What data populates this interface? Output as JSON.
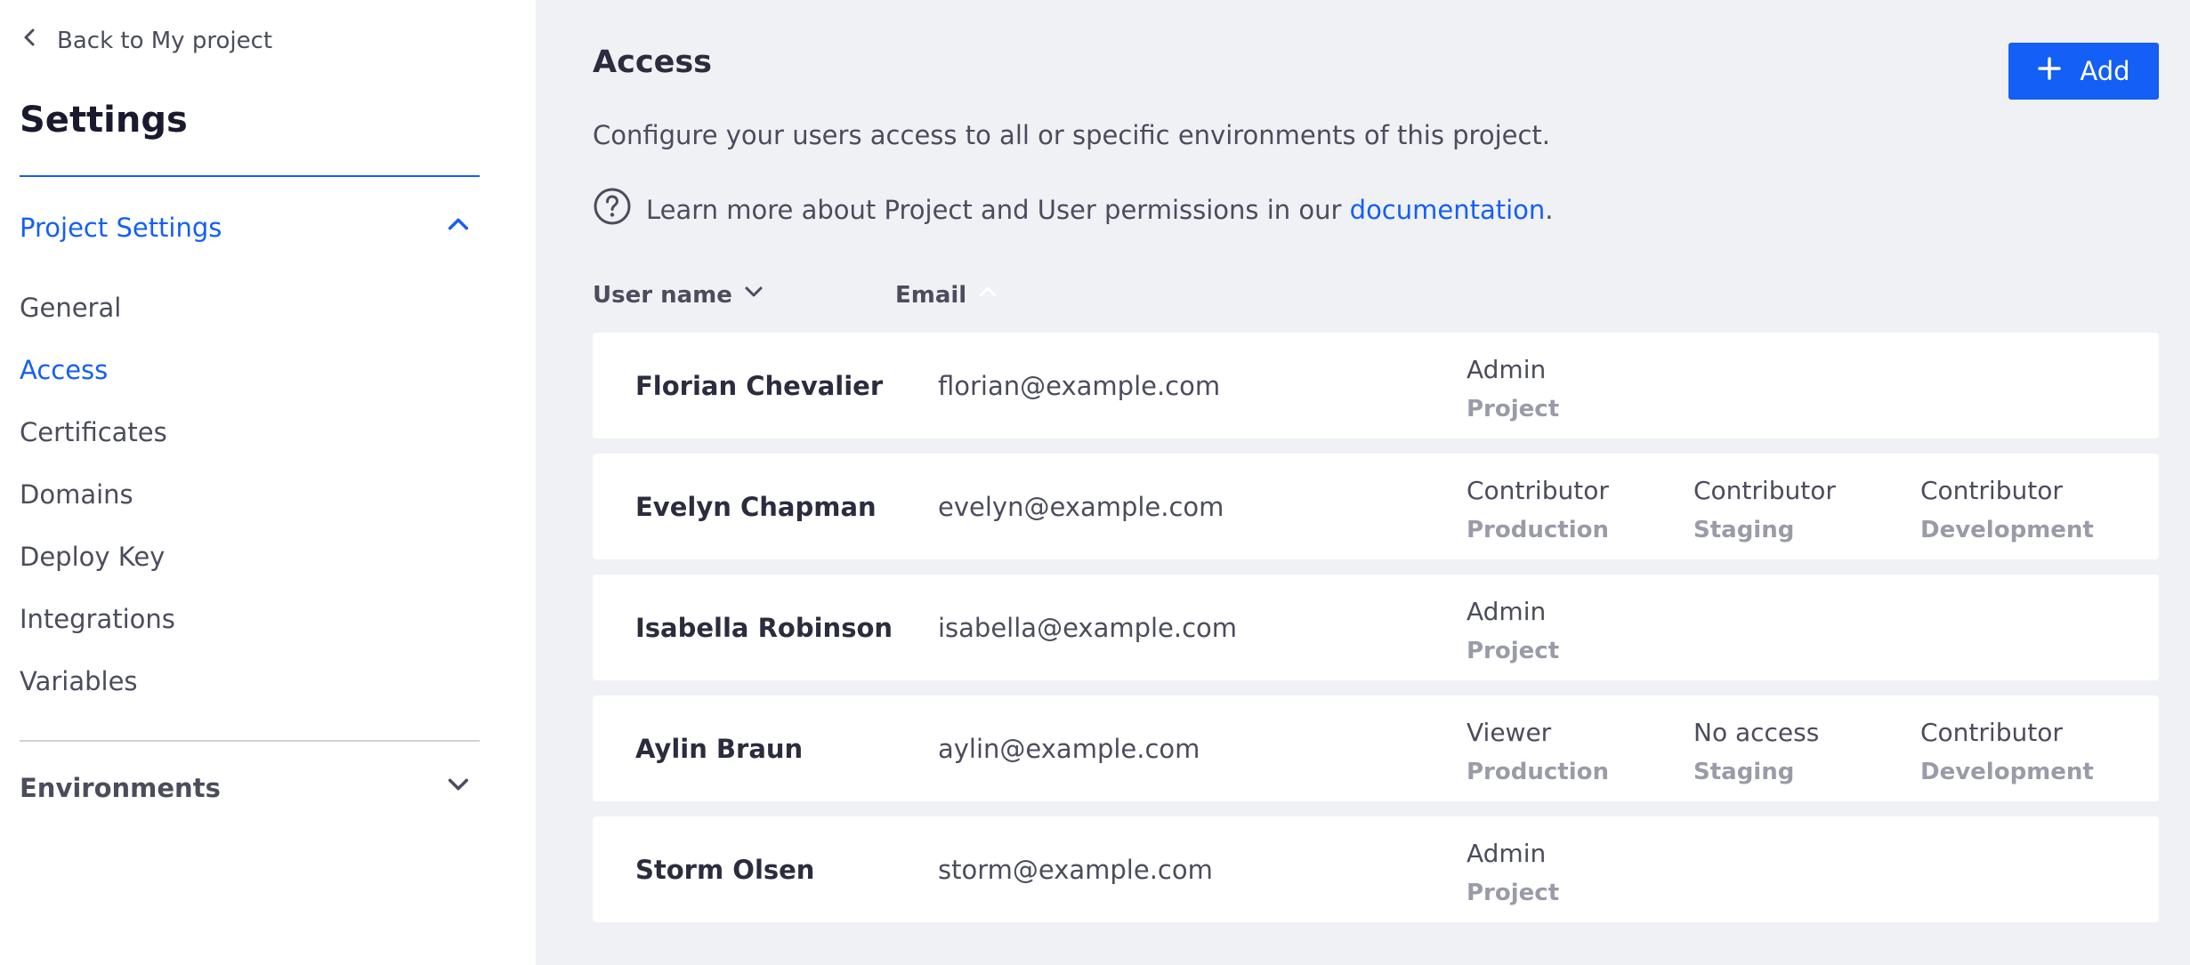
{
  "sidebar": {
    "back_label": "Back to My project",
    "title": "Settings",
    "project_settings_label": "Project Settings",
    "items": [
      {
        "label": "General"
      },
      {
        "label": "Access"
      },
      {
        "label": "Certificates"
      },
      {
        "label": "Domains"
      },
      {
        "label": "Deploy Key"
      },
      {
        "label": "Integrations"
      },
      {
        "label": "Variables"
      }
    ],
    "active_item": "Access",
    "environments_label": "Environments"
  },
  "main": {
    "title": "Access",
    "add_label": "Add",
    "description": "Configure your users access to all or specific environments of this project.",
    "help_text": "Learn more about Project and User permissions in our",
    "help_link": "documentation",
    "help_suffix": ".",
    "columns": {
      "username": "User name",
      "email": "Email"
    },
    "users": [
      {
        "name": "Florian Chevalier",
        "email": "florian@example.com",
        "permissions": [
          {
            "role": "Admin",
            "scope": "Project"
          }
        ]
      },
      {
        "name": "Evelyn Chapman",
        "email": "evelyn@example.com",
        "permissions": [
          {
            "role": "Contributor",
            "scope": "Production"
          },
          {
            "role": "Contributor",
            "scope": "Staging"
          },
          {
            "role": "Contributor",
            "scope": "Development"
          }
        ]
      },
      {
        "name": "Isabella Robinson",
        "email": "isabella@example.com",
        "permissions": [
          {
            "role": "Admin",
            "scope": "Project"
          }
        ]
      },
      {
        "name": "Aylin Braun",
        "email": "aylin@example.com",
        "permissions": [
          {
            "role": "Viewer",
            "scope": "Production"
          },
          {
            "role": "No access",
            "scope": "Staging"
          },
          {
            "role": "Contributor",
            "scope": "Development"
          }
        ]
      },
      {
        "name": "Storm Olsen",
        "email": "storm@example.com",
        "permissions": [
          {
            "role": "Admin",
            "scope": "Project"
          }
        ]
      }
    ]
  },
  "colors": {
    "accent": "#145ff5",
    "sidebar_bg": "#ffffff",
    "page_bg": "#f0f1f5",
    "muted_text": "#9a9ba8"
  },
  "icons": {
    "back": "chevron-left-icon",
    "collapse": "chevron-up-icon",
    "expand": "chevron-down-icon",
    "add": "plus-icon",
    "help": "question-circle-icon",
    "sort_username": "chevron-down-icon",
    "sort_email": "chevron-up-icon"
  }
}
